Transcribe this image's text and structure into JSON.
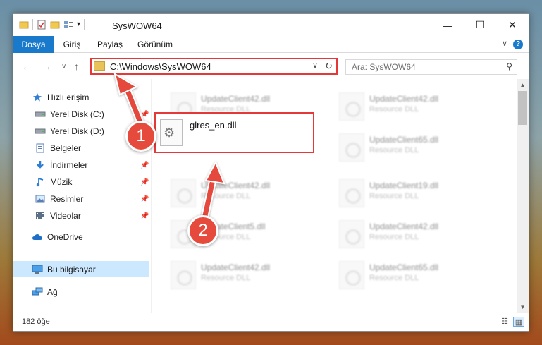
{
  "window": {
    "title": "SysWOW64",
    "minimize_glyph": "—",
    "maximize_glyph": "☐",
    "close_glyph": "✕"
  },
  "quick_access_toolbar": {
    "icons": [
      "folder-icon",
      "properties-icon",
      "new-folder-icon",
      "customize-icon"
    ],
    "dropdown_glyph": "▾"
  },
  "ribbon": {
    "tabs": [
      {
        "label": "Dosya",
        "active": true
      },
      {
        "label": "Giriş"
      },
      {
        "label": "Paylaş"
      },
      {
        "label": "Görünüm"
      }
    ],
    "expand_glyph": "∨",
    "help_glyph": "?"
  },
  "navigation": {
    "back_glyph": "←",
    "forward_glyph": "→",
    "recent_glyph": "∨",
    "up_glyph": "↑",
    "address_path": "C:\\Windows\\SysWOW64",
    "address_dropdown_glyph": "∨",
    "refresh_glyph": "↻",
    "search_placeholder": "Ara: SysWOW64",
    "search_glyph": "⚲"
  },
  "sidebar": {
    "items": [
      {
        "label": "Hızlı erişim",
        "icon": "star-icon",
        "pinned": false
      },
      {
        "label": "Yerel Disk (C:)",
        "icon": "drive-icon",
        "pinned": true
      },
      {
        "label": "Yerel Disk (D:)",
        "icon": "drive-icon",
        "pinned": false
      },
      {
        "label": "Belgeler",
        "icon": "document-icon",
        "pinned": true
      },
      {
        "label": "İndirmeler",
        "icon": "download-icon",
        "pinned": true
      },
      {
        "label": "Müzik",
        "icon": "music-icon",
        "pinned": true
      },
      {
        "label": "Resimler",
        "icon": "pictures-icon",
        "pinned": true
      },
      {
        "label": "Videolar",
        "icon": "video-icon",
        "pinned": true
      },
      {
        "label": "OneDrive",
        "icon": "cloud-icon",
        "pinned": false
      },
      {
        "label": "Bu bilgisayar",
        "icon": "computer-icon",
        "pinned": false,
        "selected": true
      },
      {
        "label": "Ağ",
        "icon": "network-icon",
        "pinned": false
      }
    ],
    "pin_glyph": "📌"
  },
  "files": {
    "type_label": "Resource DLL",
    "left_column": [
      "UpdateClient42.dll",
      "UpdateClient42.dll",
      "UpdateClient5.dll",
      "UpdateClient42.dll"
    ],
    "right_column": [
      "UpdateClient42.dll",
      "UpdateClient65.dll",
      "UpdateClient19.dll",
      "UpdateClient42.dll",
      "UpdateClient65.dll"
    ],
    "highlighted_file": "glres_en.dll"
  },
  "statusbar": {
    "item_count": "182 öğe",
    "details_view_glyph": "☷",
    "tiles_view_glyph": "▦"
  },
  "annotations": {
    "badge_1": "1",
    "badge_2": "2"
  },
  "colors": {
    "accent_blue": "#1979ca",
    "highlight_red": "#e53939",
    "badge_red": "#e54a3c",
    "selection": "#cce8ff"
  }
}
